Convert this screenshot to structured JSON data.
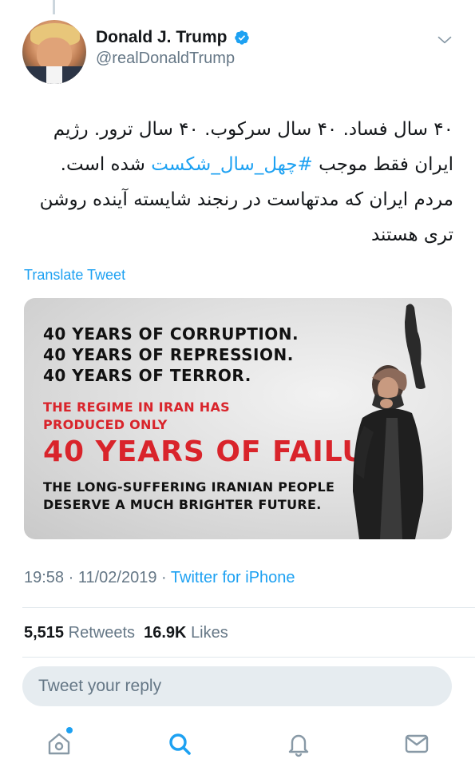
{
  "author": {
    "display_name": "Donald J. Trump",
    "handle": "@realDonaldTrump",
    "verified": true
  },
  "tweet": {
    "text_before_hashtag": "۴۰ سال فساد. ۴۰ سال سرکوب. ۴۰ سال ترور. رژیم ایران فقط موجب ",
    "hashtag": "#چهل_سال_شکست",
    "text_after_hashtag": " شده است. مردم ایران که مدتهاست در رنجند شایسته آینده روشن تری هستند",
    "translate_label": "Translate Tweet"
  },
  "media": {
    "lines": [
      "40 YEARS OF CORRUPTION.",
      "40 YEARS OF REPRESSION.",
      "40 YEARS OF TERROR.",
      "THE REGIME IN IRAN HAS",
      "PRODUCED ONLY",
      "40 YEARS OF FAILURE.",
      "THE LONG-SUFFERING IRANIAN PEOPLE",
      "DESERVE A MUCH BRIGHTER FUTURE."
    ]
  },
  "meta": {
    "time": "19:58",
    "date": "11/02/2019",
    "source": "Twitter for iPhone",
    "separator": "·"
  },
  "stats": {
    "retweets_count": "5,515",
    "retweets_label": "Retweets",
    "likes_count": "16.9K",
    "likes_label": "Likes"
  },
  "reply": {
    "placeholder": "Tweet your reply"
  },
  "tabs": {
    "home": "home-icon",
    "search": "search-icon",
    "notifications": "bell-icon",
    "messages": "envelope-icon"
  },
  "colors": {
    "accent": "#1da1f2",
    "secondary_text": "#657786",
    "media_red": "#d9242b"
  }
}
